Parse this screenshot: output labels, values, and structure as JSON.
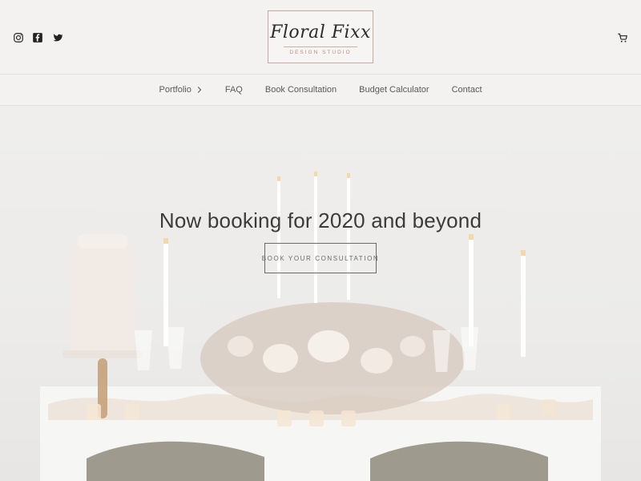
{
  "brand": {
    "logo_text": "Floral Fixx",
    "logo_subtext": "DESIGN STUDIO"
  },
  "header": {
    "social": [
      {
        "name": "instagram-icon"
      },
      {
        "name": "facebook-icon"
      },
      {
        "name": "twitter-icon"
      }
    ],
    "cart_icon": "cart-icon"
  },
  "nav": {
    "items": [
      {
        "label": "Portfolio",
        "has_chevron": true
      },
      {
        "label": "FAQ"
      },
      {
        "label": "Book Consultation"
      },
      {
        "label": "Budget Calculator"
      },
      {
        "label": "Contact"
      }
    ]
  },
  "hero": {
    "headline": "Now booking for 2020 and beyond",
    "cta_label": "BOOK YOUR CONSULTATION"
  },
  "colors": {
    "background": "#f2f1ef",
    "text": "#3b3b3b",
    "muted_text": "#6b6b6b",
    "accent_rose_gold": "#c9a79c"
  }
}
